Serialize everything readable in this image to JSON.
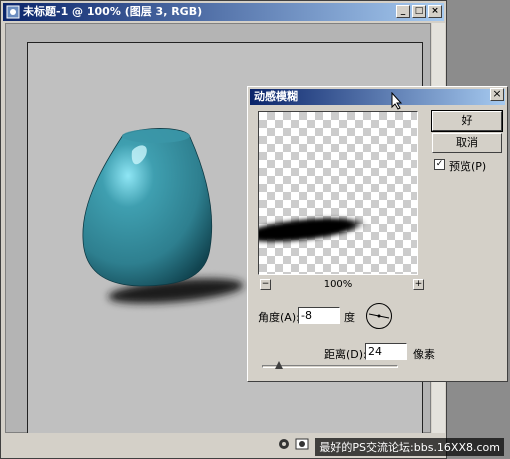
{
  "document_window": {
    "title": "未标题-1 @ 100% (图层 3, RGB)",
    "minimize": "_",
    "maximize": "□",
    "close": "×"
  },
  "colors": {
    "vase_main": "#2e7f8f",
    "vase_highlight": "#8fe6f5",
    "titlebar_start": "#0a246a",
    "titlebar_end": "#a6caf0"
  },
  "dialog": {
    "title": "动感模糊",
    "close": "×",
    "ok_label": "好",
    "cancel_label": "取消",
    "preview_checked": true,
    "preview_check_mark": "✓",
    "preview_label": "预览(P)",
    "zoom_out": "−",
    "zoom_in": "+",
    "zoom_value": "100%",
    "angle_label": "角度(A):",
    "angle_value": "-8",
    "angle_unit": "度",
    "distance_label": "距离(D):",
    "distance_value": "24",
    "distance_unit": "像素"
  },
  "watermark": "最好的PS交流论坛:bbs.16XX8.com"
}
